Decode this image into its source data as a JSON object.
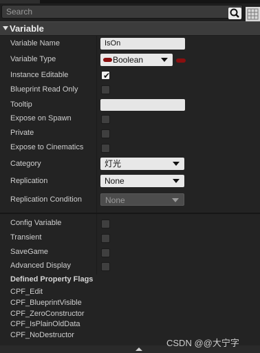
{
  "search": {
    "placeholder": "Search"
  },
  "section": {
    "title": "Variable"
  },
  "rows": {
    "variable_name": {
      "label": "Variable Name",
      "value": "IsOn"
    },
    "variable_type": {
      "label": "Variable Type",
      "value": "Boolean",
      "pin_color": "#8a0f0f"
    },
    "instance_editable": {
      "label": "Instance Editable",
      "checked": true
    },
    "blueprint_read_only": {
      "label": "Blueprint Read Only",
      "checked": false
    },
    "tooltip": {
      "label": "Tooltip",
      "value": ""
    },
    "expose_on_spawn": {
      "label": "Expose on Spawn",
      "checked": false
    },
    "private": {
      "label": "Private",
      "checked": false
    },
    "expose_to_cinematics": {
      "label": "Expose to Cinematics",
      "checked": false
    },
    "category": {
      "label": "Category",
      "value": "灯光"
    },
    "replication": {
      "label": "Replication",
      "value": "None"
    },
    "replication_condition": {
      "label": "Replication Condition",
      "value": "None"
    },
    "config_variable": {
      "label": "Config Variable",
      "checked": false
    },
    "transient": {
      "label": "Transient",
      "checked": false
    },
    "save_game": {
      "label": "SaveGame",
      "checked": false
    },
    "advanced_display": {
      "label": "Advanced Display",
      "checked": false
    }
  },
  "flags": {
    "title": "Defined Property Flags",
    "items": [
      "CPF_Edit",
      "CPF_BlueprintVisible",
      "CPF_ZeroConstructor",
      "CPF_IsPlainOldData",
      "CPF_NoDestructor"
    ]
  },
  "watermark": "CSDN @@大宁字",
  "icons": {
    "search": "search-icon",
    "grid": "grid-icon",
    "collapse": "triangle-down-icon",
    "checkmark": "checkmark-icon"
  }
}
